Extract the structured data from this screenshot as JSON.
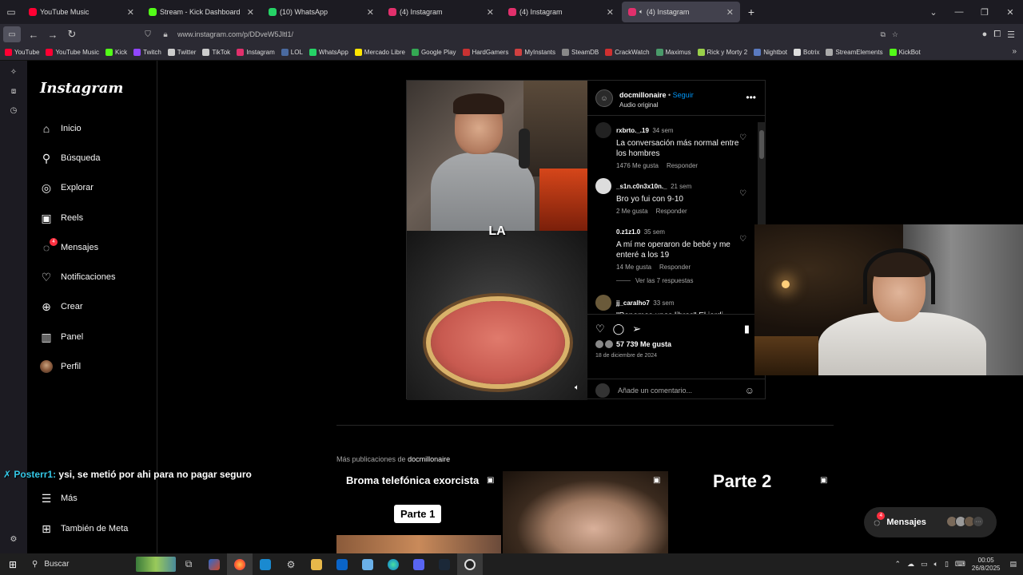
{
  "browser": {
    "tabs": [
      {
        "title": "YouTube Music",
        "color": "#ff0033"
      },
      {
        "title": "Stream - Kick Dashboard",
        "color": "#53fc18"
      },
      {
        "title": "(10) WhatsApp",
        "color": "#25d366"
      },
      {
        "title": "(4) Instagram",
        "color": "#e1306c"
      },
      {
        "title": "(4) Instagram",
        "color": "#e1306c"
      },
      {
        "title": "(4) Instagram",
        "color": "#e1306c",
        "active": true
      }
    ],
    "url": "www.instagram.com/p/DDveW5Jltl1/",
    "bookmarks": [
      {
        "label": "YouTube",
        "color": "#ff0033"
      },
      {
        "label": "YouTube Music",
        "color": "#ff0033"
      },
      {
        "label": "Kick",
        "color": "#53fc18"
      },
      {
        "label": "Twitch",
        "color": "#9146ff"
      },
      {
        "label": "Twitter",
        "color": "#cccccc"
      },
      {
        "label": "TikTok",
        "color": "#cccccc"
      },
      {
        "label": "Instagram",
        "color": "#e1306c"
      },
      {
        "label": "LOL",
        "color": "#4a6aa0"
      },
      {
        "label": "WhatsApp",
        "color": "#25d366"
      },
      {
        "label": "Mercado Libre",
        "color": "#ffe600"
      },
      {
        "label": "Google Play",
        "color": "#34a853"
      },
      {
        "label": "HardGamers",
        "color": "#c83232"
      },
      {
        "label": "MyInstants",
        "color": "#d04040"
      },
      {
        "label": "SteamDB",
        "color": "#888888"
      },
      {
        "label": "CrackWatch",
        "color": "#d03030"
      },
      {
        "label": "Maximus",
        "color": "#4a9a6a"
      },
      {
        "label": "Rick y Morty 2",
        "color": "#9ad04a"
      },
      {
        "label": "Nightbot",
        "color": "#5a7ac0"
      },
      {
        "label": "Botrix",
        "color": "#dddddd"
      },
      {
        "label": "StreamElements",
        "color": "#aaaaaa"
      },
      {
        "label": "KickBot",
        "color": "#53fc18"
      }
    ]
  },
  "instagram": {
    "logo": "Instagram",
    "nav": [
      {
        "label": "Inicio",
        "icon": "home-icon",
        "glyph": "⌂"
      },
      {
        "label": "Búsqueda",
        "icon": "search-icon",
        "glyph": "⚲"
      },
      {
        "label": "Explorar",
        "icon": "compass-icon",
        "glyph": "◎"
      },
      {
        "label": "Reels",
        "icon": "reels-icon",
        "glyph": "▣"
      },
      {
        "label": "Mensajes",
        "icon": "messenger-icon",
        "glyph": "◌",
        "badge": "4"
      },
      {
        "label": "Notificaciones",
        "icon": "heart-icon",
        "glyph": "♡"
      },
      {
        "label": "Crear",
        "icon": "plus-icon",
        "glyph": "⊕"
      },
      {
        "label": "Panel",
        "icon": "chart-icon",
        "glyph": "▥"
      },
      {
        "label": "Perfil",
        "icon": "avatar",
        "glyph": ""
      }
    ],
    "nav_bottom": [
      {
        "label": "Más",
        "icon": "menu-icon",
        "glyph": "☰"
      },
      {
        "label": "También de Meta",
        "icon": "meta-icon",
        "glyph": "⊞"
      }
    ],
    "post": {
      "username": "docmillonaire",
      "separator": " • ",
      "follow": "Seguir",
      "audio": "Audio original",
      "caption_word": "LA",
      "comments": [
        {
          "user": "rxbrto._.19",
          "time": "34 sem",
          "text": "La conversación más normal entre los hombres",
          "likes": "1476 Me gusta",
          "reply": "Responder"
        },
        {
          "user": "_s1n.c0n3x10n._",
          "time": "21 sem",
          "text": "Bro yo fui con 9-10",
          "likes": "2 Me gusta",
          "reply": "Responder"
        },
        {
          "user": "0.z1z1.0",
          "time": "35 sem",
          "text": "A mí me operaron de bebé y me enteré a los 19",
          "likes": "14 Me gusta",
          "reply": "Responder"
        },
        {
          "user": "jj_caralho7",
          "time": "33 sem",
          "text": "\"Ponemos unos libros\" El jordi",
          "likes": "",
          "reply": ""
        }
      ],
      "view_replies": "Ver las 7 respuestas",
      "likes": "57 739 Me gusta",
      "date": "18 de diciembre de 2024",
      "add_comment_placeholder": "Añade un comentario..."
    },
    "more_posts": {
      "prefix": "Más publicaciones de ",
      "user": "docmillonaire",
      "thumbs": [
        {
          "title": "Broma telefónica exorcista",
          "pill": "Parte 1"
        },
        {
          "title": ""
        },
        {
          "title": "Parte 2"
        }
      ]
    },
    "messages_float": {
      "label": "Mensajes",
      "badge": "4"
    }
  },
  "stream_chat": {
    "name": "Posterr1:",
    "text": " ysi, se metió por ahi para no pagar seguro"
  },
  "taskbar": {
    "search": "Buscar",
    "clock_time": "00:05",
    "clock_date": "26/8/2025"
  }
}
